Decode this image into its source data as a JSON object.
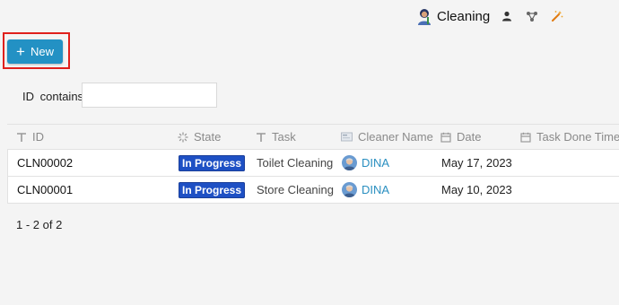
{
  "header": {
    "title": "Cleaning",
    "icons": [
      "app-avatar-icon",
      "user-icon",
      "share-icon",
      "magic-wand-icon"
    ]
  },
  "toolbar": {
    "new_label": "New",
    "new_color": "#2391c4",
    "highlight_color": "#e0201c"
  },
  "filter": {
    "label": "ID",
    "operator": "contains",
    "value": ""
  },
  "table": {
    "columns": [
      {
        "label": "ID",
        "icon": "text-icon"
      },
      {
        "label": "State",
        "icon": "spinner-icon"
      },
      {
        "label": "Task",
        "icon": "text-icon"
      },
      {
        "label": "Cleaner Name",
        "icon": "card-icon"
      },
      {
        "label": "Date",
        "icon": "calendar-icon"
      },
      {
        "label": "Task Done Time",
        "icon": "calendar-icon"
      }
    ],
    "rows": [
      {
        "id": "CLN00002",
        "state": "In Progress",
        "task": "Toilet Cleaning",
        "cleaner": "DINA",
        "date": "May 17, 2023",
        "done_time": ""
      },
      {
        "id": "CLN00001",
        "state": "In Progress",
        "task": "Store Cleaning",
        "cleaner": "DINA",
        "date": "May 10, 2023",
        "done_time": ""
      }
    ]
  },
  "pager": {
    "text": "1 - 2 of 2"
  }
}
